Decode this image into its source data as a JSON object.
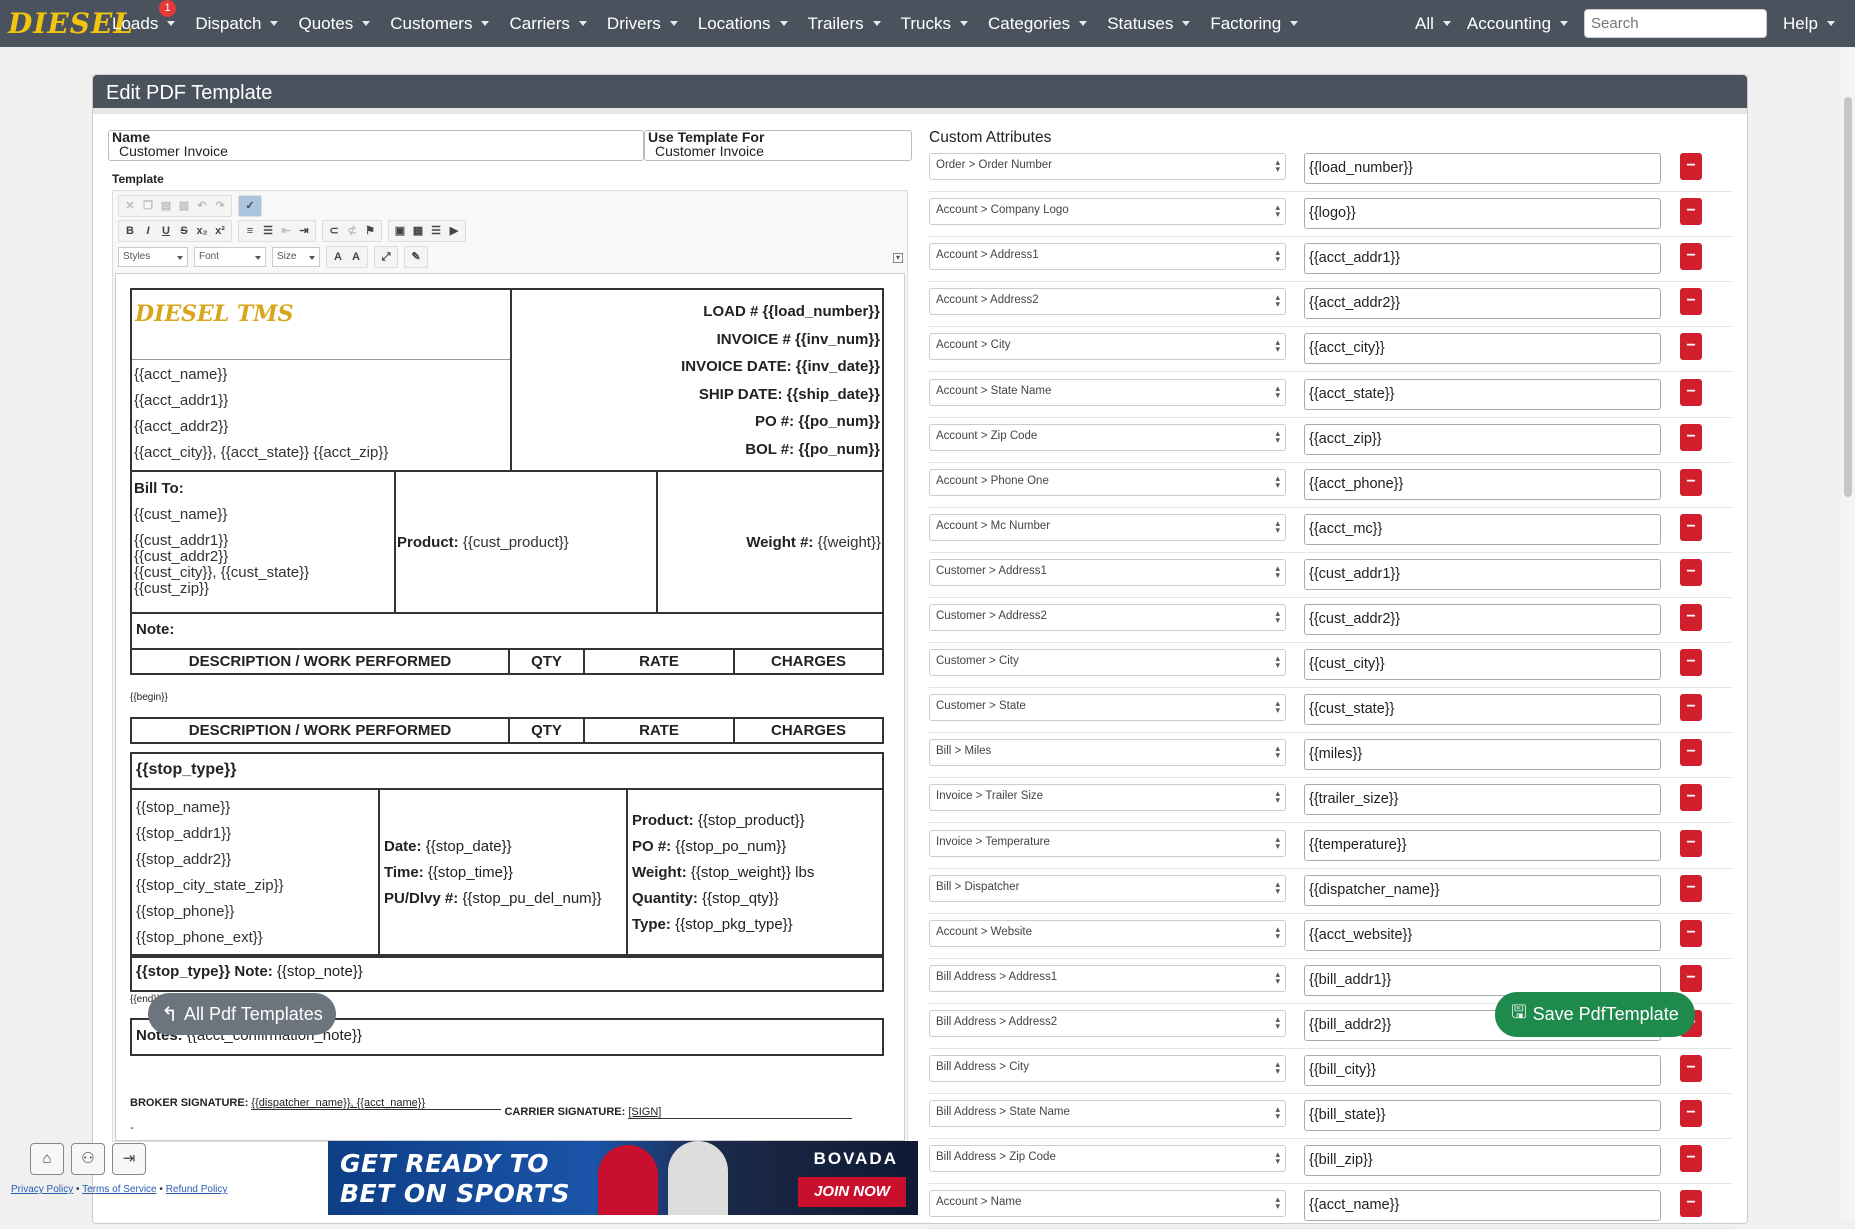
{
  "nav": {
    "brand": "DIESEL",
    "items": [
      {
        "label": "Loads",
        "badge": "1"
      },
      {
        "label": "Dispatch"
      },
      {
        "label": "Quotes"
      },
      {
        "label": "Customers"
      },
      {
        "label": "Carriers"
      },
      {
        "label": "Drivers"
      },
      {
        "label": "Locations"
      },
      {
        "label": "Trailers"
      },
      {
        "label": "Trucks"
      },
      {
        "label": "Categories"
      },
      {
        "label": "Statuses"
      },
      {
        "label": "Factoring"
      }
    ],
    "right": {
      "all": "All",
      "accounting": "Accounting",
      "search_placeholder": "Search",
      "help": "Help"
    }
  },
  "panel": {
    "title": "Edit PDF Template"
  },
  "form": {
    "name_label": "Name",
    "name_value": "Customer Invoice",
    "use_for_label": "Use Template For",
    "use_for_value": "Customer Invoice",
    "template_label": "Template"
  },
  "editor": {
    "combos": {
      "styles": "Styles",
      "font": "Font",
      "size": "Size"
    }
  },
  "doc": {
    "logo_text": "DIESEL TMS",
    "acct_lines": [
      "{{acct_name}}",
      "{{acct_addr1}}",
      "{{acct_addr2}}",
      "{{acct_city}}, {{acct_state}} {{acct_zip}}"
    ],
    "header_right": [
      "LOAD # {{load_number}}",
      "INVOICE # {{inv_num}}",
      "INVOICE DATE: {{inv_date}}",
      "SHIP DATE: {{ship_date}}",
      "PO #: {{po_num}}",
      "BOL #: {{po_num}}"
    ],
    "bill_to_label": "Bill To:",
    "cust_name": "{{cust_name}}",
    "cust_addr": [
      "{{cust_addr1}}",
      "{{cust_addr2}}",
      "{{cust_city}}, {{cust_state}}",
      "{{cust_zip}}"
    ],
    "product_label": "Product:",
    "product_value": "{{cust_product}}",
    "weight_label": "Weight #:",
    "weight_value": "{{weight}}",
    "note_label": "Note:",
    "columns": [
      "DESCRIPTION / WORK PERFORMED",
      "QTY",
      "RATE",
      "CHARGES"
    ],
    "begin_tag": "{{begin}}",
    "stop_type": "{{stop_type}}",
    "stop_lines": [
      "{{stop_name}}",
      "{{stop_addr1}}",
      "{{stop_addr2}}",
      "{{stop_city_state_zip}}",
      "{{stop_phone}}",
      "{{stop_phone_ext}}"
    ],
    "stop_mid": [
      {
        "label": "Date:",
        "value": "{{stop_date}}"
      },
      {
        "label": "Time:",
        "value": "{{stop_time}}"
      },
      {
        "label": "PU/Dlvy #:",
        "value": "{{stop_pu_del_num}}"
      }
    ],
    "stop_right": [
      {
        "label": "Product:",
        "value": "{{stop_product}}"
      },
      {
        "label": "PO #:",
        "value": "{{stop_po_num}}"
      },
      {
        "label": "Weight:",
        "value": "{{stop_weight}} lbs"
      },
      {
        "label": "Quantity:",
        "value": "{{stop_qty}}"
      },
      {
        "label": "Type:",
        "value": "{{stop_pkg_type}}"
      }
    ],
    "stop_note_label": "{{stop_type}} Note:",
    "stop_note_value": "{{stop_note}}",
    "end_tag": "{{end}}",
    "notes_label": "Notes:",
    "notes_value": "{{acct_confirmation_note}}",
    "broker_sig_label": "BROKER SIGNATURE:",
    "broker_sig_value": "{{dispatcher_name}}, {{acct_name}}",
    "carrier_sig_label": "CARRIER SIGNATURE:",
    "carrier_sig_value": "[SIGN]",
    "dash": "-"
  },
  "attributes": {
    "title": "Custom Attributes",
    "rows": [
      {
        "field": "Order > Order Number",
        "tag": "{{load_number}}"
      },
      {
        "field": "Account > Company Logo",
        "tag": "{{logo}}"
      },
      {
        "field": "Account > Address1",
        "tag": "{{acct_addr1}}"
      },
      {
        "field": "Account > Address2",
        "tag": "{{acct_addr2}}"
      },
      {
        "field": "Account > City",
        "tag": "{{acct_city}}"
      },
      {
        "field": "Account > State Name",
        "tag": "{{acct_state}}"
      },
      {
        "field": "Account > Zip Code",
        "tag": "{{acct_zip}}"
      },
      {
        "field": "Account > Phone One",
        "tag": "{{acct_phone}}"
      },
      {
        "field": "Account > Mc Number",
        "tag": "{{acct_mc}}"
      },
      {
        "field": "Customer > Address1",
        "tag": "{{cust_addr1}}"
      },
      {
        "field": "Customer > Address2",
        "tag": "{{cust_addr2}}"
      },
      {
        "field": "Customer > City",
        "tag": "{{cust_city}}"
      },
      {
        "field": "Customer > State",
        "tag": "{{cust_state}}"
      },
      {
        "field": "Bill > Miles",
        "tag": "{{miles}}"
      },
      {
        "field": "Invoice > Trailer Size",
        "tag": "{{trailer_size}}"
      },
      {
        "field": "Invoice > Temperature",
        "tag": "{{temperature}}"
      },
      {
        "field": "Bill > Dispatcher",
        "tag": "{{dispatcher_name}}"
      },
      {
        "field": "Account > Website",
        "tag": "{{acct_website}}"
      },
      {
        "field": "Bill Address > Address1",
        "tag": "{{bill_addr1}}"
      },
      {
        "field": "Bill Address > Address2",
        "tag": "{{bill_addr2}}"
      },
      {
        "field": "Bill Address > City",
        "tag": "{{bill_city}}"
      },
      {
        "field": "Bill Address > State Name",
        "tag": "{{bill_state}}"
      },
      {
        "field": "Bill Address > Zip Code",
        "tag": "{{bill_zip}}"
      },
      {
        "field": "Account > Name",
        "tag": "{{acct_name}}"
      }
    ]
  },
  "buttons": {
    "all_templates": "All Pdf Templates",
    "save": "Save PdfTemplate"
  },
  "footer": {
    "privacy": "Privacy Policy",
    "terms": "Terms of Service",
    "refund": "Refund Policy",
    "sep": "•"
  },
  "ad": {
    "line1": "GET READY TO",
    "line2": "BET ON SPORTS",
    "brand": "BOVADA",
    "cta": "JOIN NOW"
  },
  "colors": {
    "navbar": "#4a535d",
    "delete": "#d11f2e",
    "save": "#1e8a4c",
    "badge": "#e53935"
  }
}
